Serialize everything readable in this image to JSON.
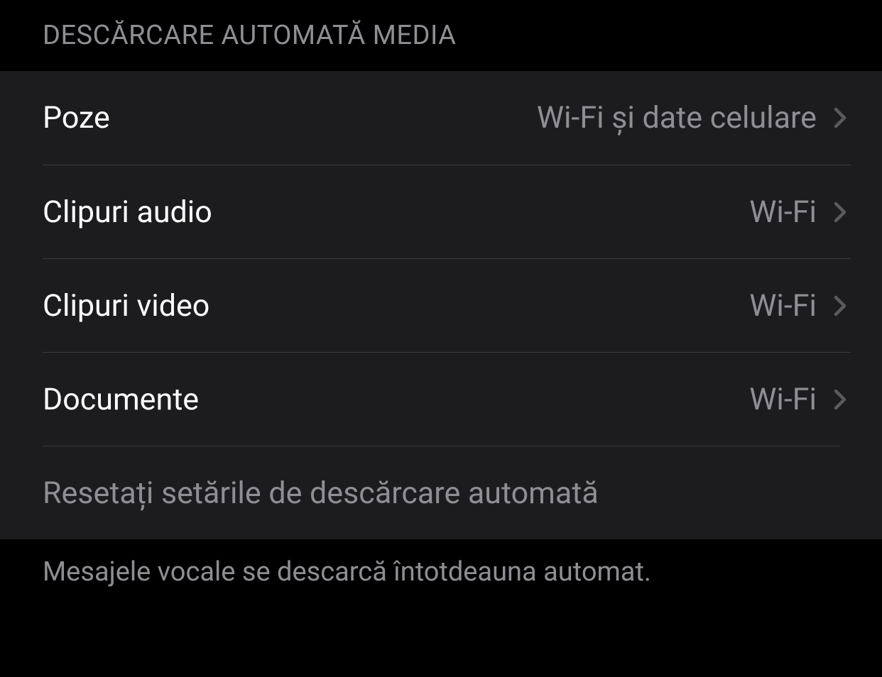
{
  "section": {
    "header": "DESCĂRCARE AUTOMATĂ MEDIA",
    "items": [
      {
        "label": "Poze",
        "value": "Wi-Fi și date celulare"
      },
      {
        "label": "Clipuri audio",
        "value": "Wi-Fi"
      },
      {
        "label": "Clipuri video",
        "value": "Wi-Fi"
      },
      {
        "label": "Documente",
        "value": "Wi-Fi"
      }
    ],
    "reset_label": "Resetați setările de descărcare automată",
    "footer": "Mesajele vocale se descarcă întotdeauna automat."
  }
}
